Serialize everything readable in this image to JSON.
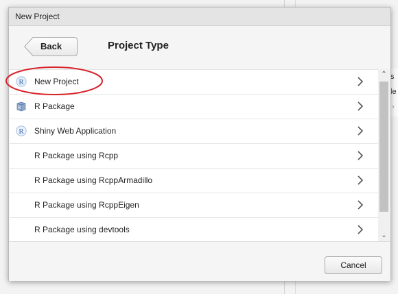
{
  "dialog": {
    "title": "New Project",
    "back_label": "Back",
    "section_title": "Project Type",
    "cancel_label": "Cancel"
  },
  "project_types": [
    {
      "label": "New Project",
      "icon": "r-project-icon"
    },
    {
      "label": "R Package",
      "icon": "r-package-icon"
    },
    {
      "label": "Shiny Web Application",
      "icon": "shiny-icon"
    },
    {
      "label": "R Package using Rcpp",
      "icon": ""
    },
    {
      "label": "R Package using RcppArmadillo",
      "icon": ""
    },
    {
      "label": "R Package using RcppEigen",
      "icon": ""
    },
    {
      "label": "R Package using devtools",
      "icon": ""
    }
  ],
  "background": {
    "panel_text_1": "s",
    "panel_text_2": "le"
  },
  "colors": {
    "annotation": "#d9242b",
    "r_icon_blue": "#3a6fb5"
  }
}
